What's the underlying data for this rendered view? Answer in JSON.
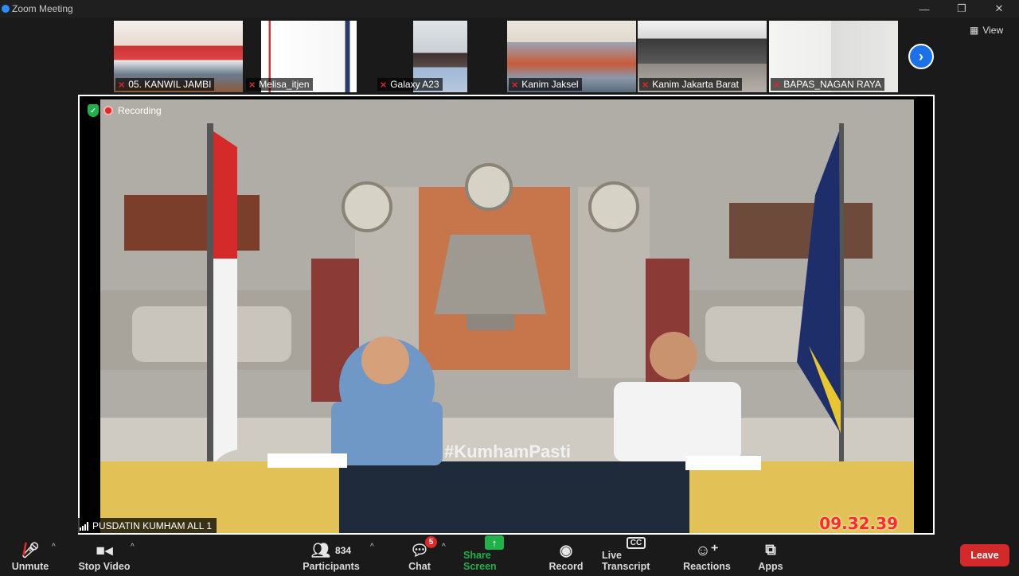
{
  "window": {
    "title": "Zoom Meeting",
    "controls": [
      "—",
      "❐",
      "✕"
    ]
  },
  "gallery": {
    "tiles": [
      {
        "name": "05. KANWIL JAMBI"
      },
      {
        "name": "Melisa_itjen"
      },
      {
        "name": "Galaxy A23"
      },
      {
        "name": "Kanim Jaksel"
      },
      {
        "name": "Kanim Jakarta Barat"
      },
      {
        "name": "BAPAS_NAGAN RAYA"
      }
    ],
    "next_icon": "chevron-right-icon",
    "view_label": "View"
  },
  "main_video": {
    "recording_label": "Recording",
    "timestamp": "09.32.39",
    "hashtag": "#KumhamPasti",
    "speaker_name": "PUSDATIN KUMHAM ALL 1"
  },
  "toolbar": {
    "unmute": "Unmute",
    "stop_video": "Stop Video",
    "participants": "Participants",
    "participants_count": "834",
    "chat": "Chat",
    "chat_badge": "5",
    "share_screen": "Share Screen",
    "record": "Record",
    "live_transcript": "Live Transcript",
    "reactions": "Reactions",
    "apps": "Apps",
    "leave": "Leave"
  },
  "colors": {
    "accent": "#2d8cff",
    "share": "#21b14a",
    "leave": "#d22a2a",
    "muted": "#e02828"
  }
}
